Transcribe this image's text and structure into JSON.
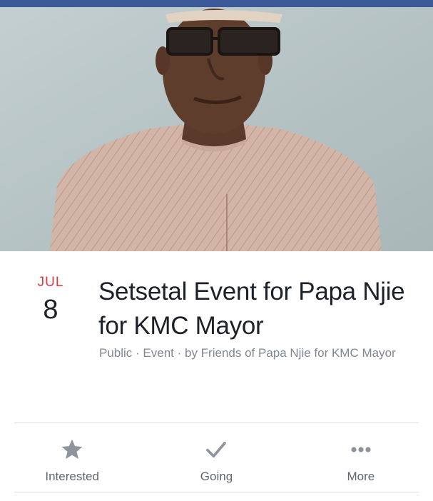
{
  "event": {
    "month": "JUL",
    "day": "8",
    "title": "Setsetal Event for Papa Njie for KMC Mayor",
    "meta": "Public · Event · by Friends of Papa Njie for KMC Mayor"
  },
  "actions": [
    {
      "label": "Interested",
      "icon": "star-icon"
    },
    {
      "label": "Going",
      "icon": "checkmark-icon"
    },
    {
      "label": "More",
      "icon": "more-dots-icon"
    }
  ],
  "colors": {
    "top_bar": "#3b5998",
    "month": "#e0393e",
    "title": "#1d2129",
    "meta": "#7f8791",
    "action_icon": "#8d949e",
    "action_label": "#606770"
  }
}
